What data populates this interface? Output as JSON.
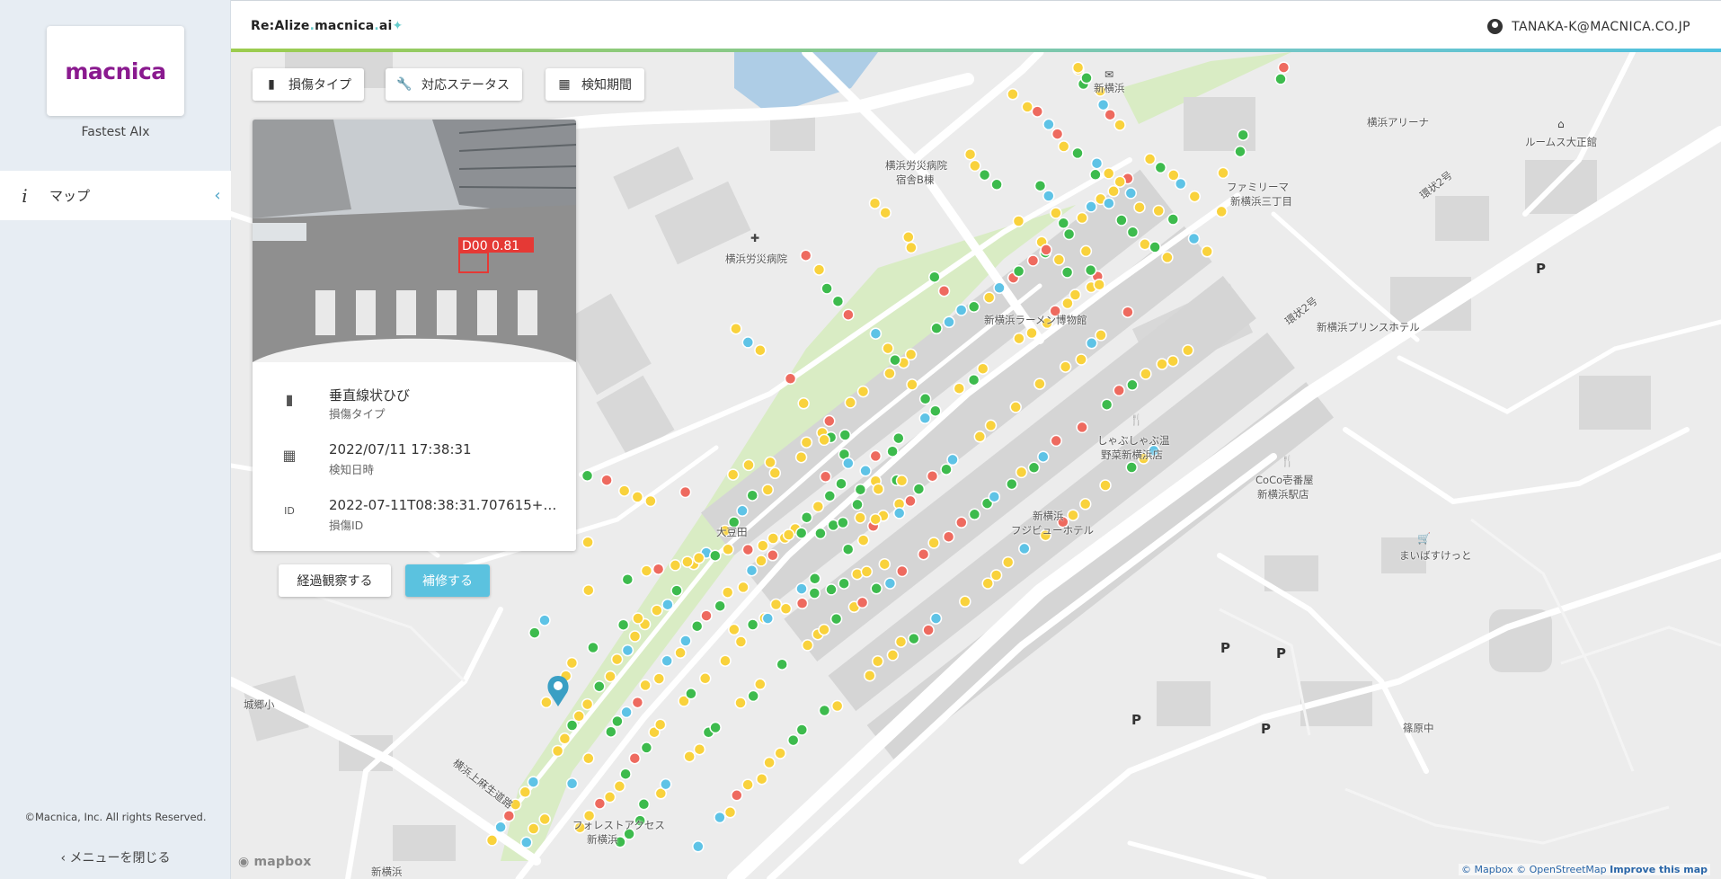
{
  "sidebar": {
    "logo_text": "macnica",
    "app_name": "Fastest AIx",
    "nav_items": [
      {
        "label": "マップ",
        "icon": "info-icon"
      }
    ],
    "copyright": "©Macnica, Inc. All rights Reserved.",
    "close_menu": "メニューを閉じる"
  },
  "header": {
    "title_part1": "Re:Alize",
    "title_part2": "macnica",
    "title_part3": "ai",
    "user_email": "TANAKA-K@MACNICA.CO.JP"
  },
  "filters": {
    "damage_type": "損傷タイプ",
    "status": "対応ステータス",
    "period": "検知期間"
  },
  "detail": {
    "photo_label": "D00  0.81",
    "damage_type_value": "垂直線状ひび",
    "damage_type_label": "損傷タイプ",
    "detected_value": "2022/07/11 17:38:31",
    "detected_label": "検知日時",
    "id_value": "2022-07-11T08:38:31.707615+0...",
    "id_label": "損傷ID",
    "id_icon_text": "ID"
  },
  "actions": {
    "observe": "経過観察する",
    "repair": "補修する"
  },
  "map_labels": {
    "shin_yokohama": "新横浜",
    "arena": "横浜アリーナ",
    "rooms": "ルームス大正館",
    "rosai_hospital": "横浜労災病院",
    "dorm_b": "宿舎B棟",
    "rosai_hospital2": "横浜労災病院",
    "family_mart": "ファミリーマ",
    "family_mart2": "新横浜三丁目",
    "ring2": "環状2号",
    "ring2b": "環状2号",
    "ramen": "新横浜ラーメン博物館",
    "prince": "新横浜プリンスホテル",
    "shabu": "しゃぶしゃぶ温",
    "shabu2": "野菜新横浜店",
    "coco": "CoCo壱番屋",
    "coco2": "新横浜駅店",
    "fujibi": "新横浜",
    "fujibi2": "フジビューホテル",
    "mybasket": "まいばすけっと",
    "ota": "大豆田",
    "jogo": "城郷小",
    "shinohara": "篠原中",
    "road": "横浜上麻生道路",
    "forest": "フォレストアクセス",
    "forest2": "新横浜",
    "bottom": "新横浜",
    "p": "P"
  },
  "map_footer": {
    "mapbox": "mapbox",
    "attr_mapbox": "© Mapbox",
    "attr_osm": "© OpenStreetMap",
    "attr_improve": "Improve this map"
  },
  "colors": {
    "severity_high": "#ee6a5f",
    "severity_mid": "#f9d23c",
    "severity_low": "#3dbb4d",
    "severity_info": "#5ec3e6",
    "accent": "#5bc2df"
  }
}
